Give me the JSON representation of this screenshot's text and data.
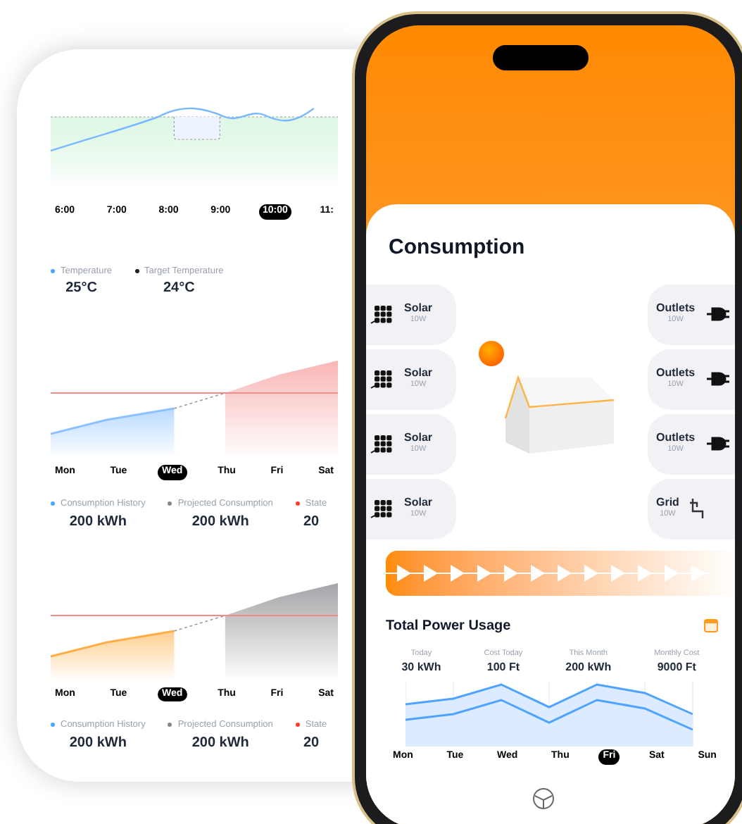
{
  "back_screen": {
    "temperature": {
      "x_labels": [
        {
          "label": "6:00",
          "selected": false
        },
        {
          "label": "7:00",
          "selected": false
        },
        {
          "label": "8:00",
          "selected": false
        },
        {
          "label": "9:00",
          "selected": false
        },
        {
          "label": "10:00",
          "selected": true
        },
        {
          "label": "11:",
          "selected": false
        }
      ],
      "legend": [
        {
          "label": "Temperature",
          "value": "25°C",
          "color": "#4da3ff"
        },
        {
          "label": "Target Temperature",
          "value": "24°C",
          "color": "#222222"
        }
      ]
    },
    "consumption_charts": [
      {
        "kind": "cool",
        "x_labels": [
          {
            "label": "Mon",
            "selected": false
          },
          {
            "label": "Tue",
            "selected": false
          },
          {
            "label": "Wed",
            "selected": true
          },
          {
            "label": "Thu",
            "selected": false
          },
          {
            "label": "Fri",
            "selected": false
          },
          {
            "label": "Sat",
            "selected": false
          }
        ],
        "legend": [
          {
            "label": "Consumption History",
            "value": "200 kWh",
            "color": "#4da3ff"
          },
          {
            "label": "Projected Consumption",
            "value": "200 kWh",
            "color": "#888888"
          },
          {
            "label": "State",
            "value": "20",
            "color": "#ff3b30"
          }
        ]
      },
      {
        "kind": "warm",
        "x_labels": [
          {
            "label": "Mon",
            "selected": false
          },
          {
            "label": "Tue",
            "selected": false
          },
          {
            "label": "Wed",
            "selected": true
          },
          {
            "label": "Thu",
            "selected": false
          },
          {
            "label": "Fri",
            "selected": false
          },
          {
            "label": "Sat",
            "selected": false
          }
        ],
        "legend": [
          {
            "label": "Consumption History",
            "value": "200 kWh",
            "color": "#4da3ff"
          },
          {
            "label": "Projected Consumption",
            "value": "200 kWh",
            "color": "#888888"
          },
          {
            "label": "State",
            "value": "20",
            "color": "#ff3b30"
          }
        ]
      }
    ]
  },
  "phone": {
    "title": "Consumption",
    "sources": [
      {
        "kind": "solar",
        "label": "Solar",
        "value": "10W"
      },
      {
        "kind": "solar",
        "label": "Solar",
        "value": "10W"
      },
      {
        "kind": "solar",
        "label": "Solar",
        "value": "10W"
      },
      {
        "kind": "solar",
        "label": "Solar",
        "value": "10W"
      }
    ],
    "loads": [
      {
        "kind": "outlet",
        "label": "Outlets",
        "value": "10W"
      },
      {
        "kind": "outlet",
        "label": "Outlets",
        "value": "10W"
      },
      {
        "kind": "outlet",
        "label": "Outlets",
        "value": "10W"
      },
      {
        "kind": "grid",
        "label": "Grid",
        "value": "10W"
      }
    ],
    "usage": {
      "title": "Total Power Usage",
      "stats": [
        {
          "label": "Today",
          "value": "30 kWh"
        },
        {
          "label": "Cost Today",
          "value": "100 Ft"
        },
        {
          "label": "This Month",
          "value": "200 kWh"
        },
        {
          "label": "Monthly Cost",
          "value": "9000 Ft"
        }
      ],
      "x_labels": [
        {
          "label": "Mon",
          "selected": false
        },
        {
          "label": "Tue",
          "selected": false
        },
        {
          "label": "Wed",
          "selected": false
        },
        {
          "label": "Thu",
          "selected": false
        },
        {
          "label": "Fri",
          "selected": true
        },
        {
          "label": "Sat",
          "selected": false
        },
        {
          "label": "Sun",
          "selected": false
        }
      ]
    }
  }
}
